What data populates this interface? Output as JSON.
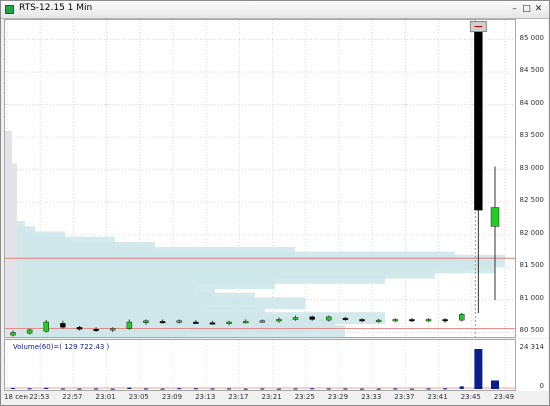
{
  "window": {
    "title": "RTS-12.15 1 Min"
  },
  "chart": {
    "price_labels": [
      "85 000",
      "84 500",
      "84 000",
      "83 500",
      "83 000",
      "82 500",
      "82 000",
      "81 500",
      "81 000",
      "80 500"
    ],
    "time_labels": [
      "18 сен",
      "22:53",
      "22:57",
      "23:01",
      "23:05",
      "23:09",
      "23:13",
      "23:17",
      "23:21",
      "23:25",
      "23:29",
      "23:33",
      "23:37",
      "23:41",
      "23:45",
      "23:49"
    ],
    "volume_label": "Volume(60)=( 129 722.43 )",
    "volume_axis_labels": [
      "24 314",
      "0"
    ],
    "colors": {
      "up": "#22cc22",
      "down": "#000000",
      "profile": "#cfe7ea",
      "volume": "#0b1c8c",
      "guide": "#e08080"
    }
  },
  "chart_data": {
    "type": "candlestick",
    "title": "RTS-12.15 1 Min",
    "ylim": [
      80400,
      85300
    ],
    "candles": [
      {
        "t": "22:50",
        "o": 80460,
        "h": 80530,
        "l": 80440,
        "c": 80500
      },
      {
        "t": "22:51",
        "o": 80490,
        "h": 80560,
        "l": 80470,
        "c": 80540
      },
      {
        "t": "22:52",
        "o": 80520,
        "h": 80690,
        "l": 80500,
        "c": 80660
      },
      {
        "t": "22:53",
        "o": 80640,
        "h": 80680,
        "l": 80560,
        "c": 80580
      },
      {
        "t": "22:54",
        "o": 80580,
        "h": 80600,
        "l": 80530,
        "c": 80550
      },
      {
        "t": "22:55",
        "o": 80550,
        "h": 80580,
        "l": 80510,
        "c": 80540
      },
      {
        "t": "22:56",
        "o": 80540,
        "h": 80580,
        "l": 80510,
        "c": 80560
      },
      {
        "t": "22:57",
        "o": 80560,
        "h": 80700,
        "l": 80540,
        "c": 80660
      },
      {
        "t": "22:58",
        "o": 80650,
        "h": 80700,
        "l": 80620,
        "c": 80680
      },
      {
        "t": "22:59",
        "o": 80670,
        "h": 80700,
        "l": 80640,
        "c": 80660
      },
      {
        "t": "23:01",
        "o": 80660,
        "h": 80700,
        "l": 80640,
        "c": 80680
      },
      {
        "t": "23:05",
        "o": 80660,
        "h": 80690,
        "l": 80630,
        "c": 80650
      },
      {
        "t": "23:09",
        "o": 80650,
        "h": 80680,
        "l": 80620,
        "c": 80640
      },
      {
        "t": "23:13",
        "o": 80640,
        "h": 80680,
        "l": 80610,
        "c": 80660
      },
      {
        "t": "23:17",
        "o": 80660,
        "h": 80700,
        "l": 80640,
        "c": 80670
      },
      {
        "t": "23:21",
        "o": 80670,
        "h": 80700,
        "l": 80650,
        "c": 80680
      },
      {
        "t": "23:25",
        "o": 80680,
        "h": 80730,
        "l": 80650,
        "c": 80700
      },
      {
        "t": "23:27",
        "o": 80700,
        "h": 80760,
        "l": 80680,
        "c": 80730
      },
      {
        "t": "23:29",
        "o": 80740,
        "h": 80760,
        "l": 80680,
        "c": 80700
      },
      {
        "t": "23:31",
        "o": 80690,
        "h": 80760,
        "l": 80670,
        "c": 80740
      },
      {
        "t": "23:33",
        "o": 80720,
        "h": 80740,
        "l": 80680,
        "c": 80700
      },
      {
        "t": "23:35",
        "o": 80700,
        "h": 80720,
        "l": 80660,
        "c": 80680
      },
      {
        "t": "23:37",
        "o": 80680,
        "h": 80710,
        "l": 80650,
        "c": 80690
      },
      {
        "t": "23:39",
        "o": 80690,
        "h": 80720,
        "l": 80660,
        "c": 80700
      },
      {
        "t": "23:41",
        "o": 80700,
        "h": 80720,
        "l": 80660,
        "c": 80690
      },
      {
        "t": "23:43",
        "o": 80690,
        "h": 80720,
        "l": 80660,
        "c": 80700
      },
      {
        "t": "23:45",
        "o": 80700,
        "h": 80720,
        "l": 80650,
        "c": 80680
      },
      {
        "t": "23:47",
        "o": 80690,
        "h": 80800,
        "l": 80670,
        "c": 80780
      },
      {
        "t": "23:49",
        "o": 85150,
        "h": 85250,
        "l": 80800,
        "c": 82380
      },
      {
        "t": "23:50",
        "o": 82130,
        "h": 83050,
        "l": 81000,
        "c": 82420
      }
    ],
    "volume": [
      600,
      400,
      700,
      300,
      200,
      300,
      200,
      800,
      300,
      200,
      500,
      400,
      300,
      300,
      200,
      300,
      200,
      300,
      400,
      300,
      300,
      200,
      200,
      300,
      200,
      300,
      400,
      1600,
      24314,
      5200
    ],
    "volume_ylim": [
      0,
      24314
    ],
    "volume_profile_note": "horizontal volume profile bars, widest near 81 600"
  }
}
